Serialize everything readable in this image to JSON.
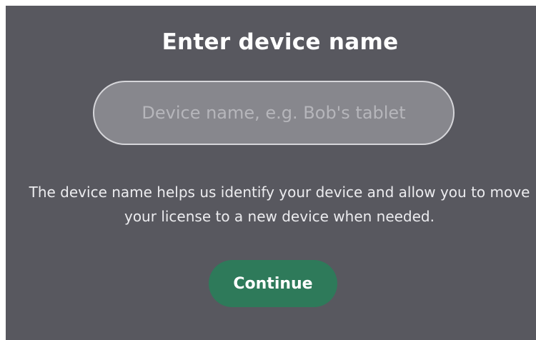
{
  "dialog": {
    "title": "Enter device name",
    "device_name_input": {
      "value": "",
      "placeholder": "Device name, e.g. Bob's tablet"
    },
    "helper_text": "The device name helps us identify your device and allow you to move your license to a new device when needed.",
    "continue_label": "Continue",
    "colors": {
      "background": "#58585f",
      "input_fill": "#87878d",
      "input_border": "#d6d6da",
      "button": "#2e7a5a",
      "text": "#ffffff"
    }
  }
}
